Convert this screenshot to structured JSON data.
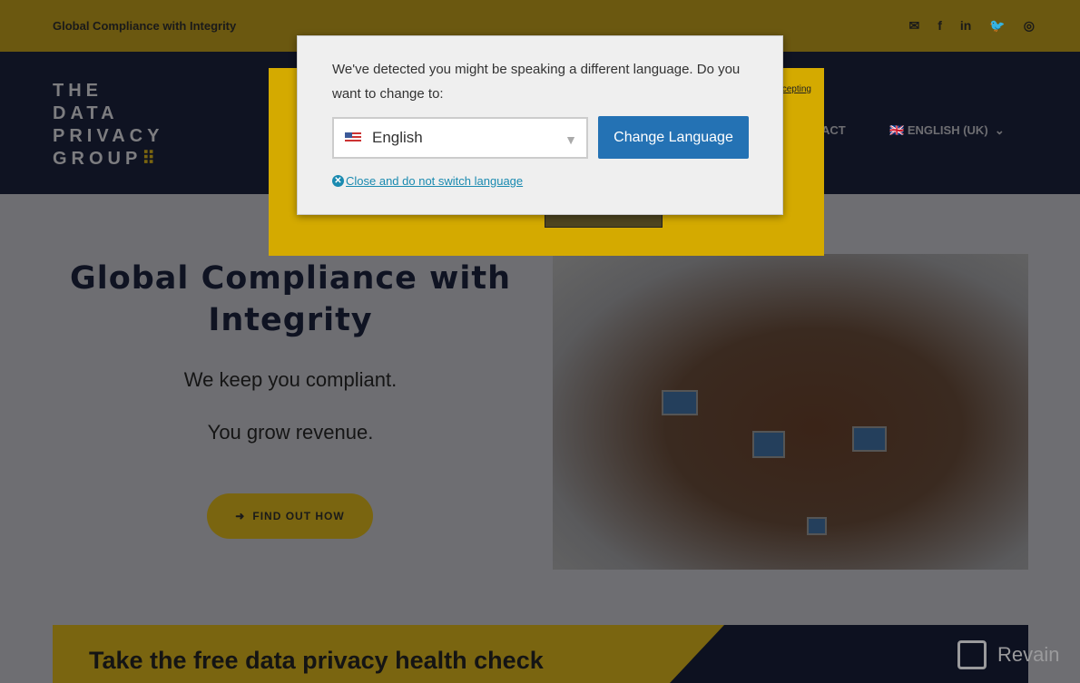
{
  "topbar": {
    "tagline": "Global Compliance with Integrity",
    "social": [
      {
        "icon": "envelope-icon",
        "glyph": "✉"
      },
      {
        "icon": "facebook-icon",
        "glyph": "f"
      },
      {
        "icon": "linkedin-icon",
        "glyph": "in"
      },
      {
        "icon": "twitter-icon",
        "glyph": "🐦"
      },
      {
        "icon": "instagram-icon",
        "glyph": "◎"
      }
    ]
  },
  "logo": {
    "line1": "THE",
    "line2": "DATA",
    "line3": "PRIVACY",
    "line4": "GROUP",
    "dots": "⠿"
  },
  "nav": {
    "contact_partial": "ACT",
    "language": "ENGLISH (UK)",
    "lang_flag": "🇬🇧",
    "chevron": "⌄"
  },
  "hero": {
    "title": "Global Compliance with Integrity",
    "sub1": "We keep you compliant.",
    "sub2": "You grow revenue.",
    "cta": "FIND OUT HOW",
    "cta_icon": "➜"
  },
  "banner": {
    "title": "Take the free data privacy health check"
  },
  "cookie": {
    "link_partial": "cepting"
  },
  "dialog": {
    "message": "We've detected you might be speaking a different language. Do you want to change to:",
    "selected": "English",
    "arrow": "▼",
    "change_button": "Change Language",
    "close_link": "Close and do not switch language",
    "close_icon": "✕"
  },
  "watermark": {
    "text": "Revain"
  },
  "colors": {
    "accent": "#d4aa00",
    "navy": "#0f1322",
    "button": "#2472b4"
  }
}
